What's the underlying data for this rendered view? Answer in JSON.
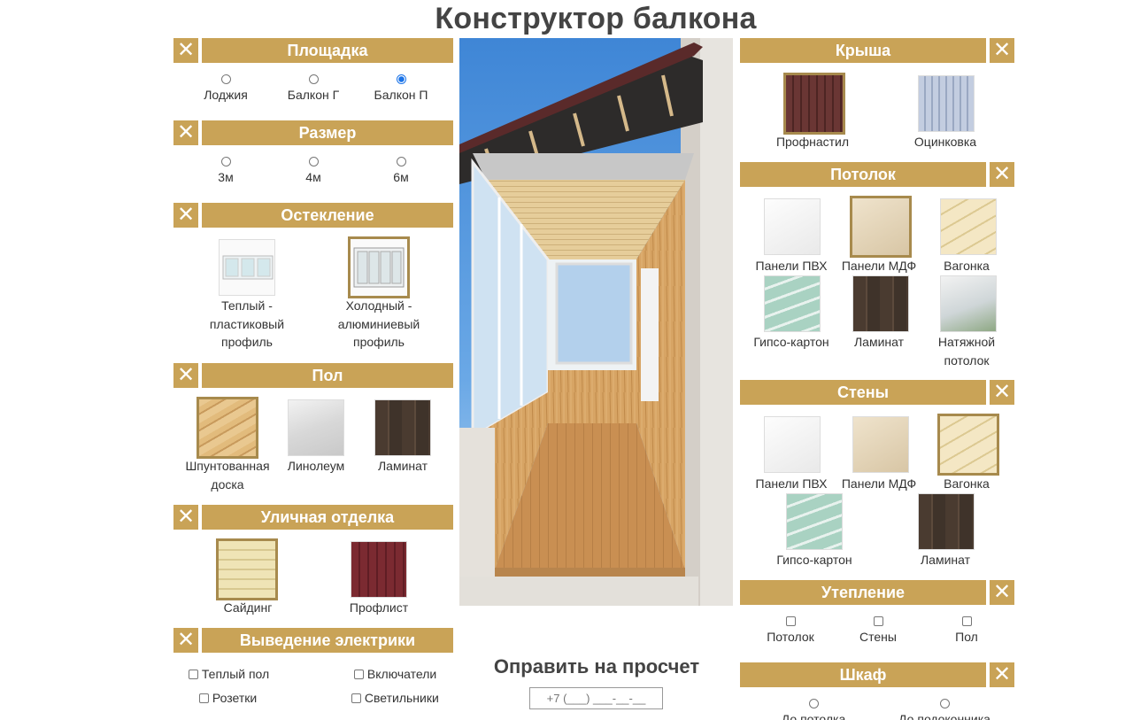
{
  "page_title": "Конструктор балкона",
  "colors": {
    "accent": "#c9a357",
    "selected_border": "#a78a4d",
    "radio_checked": "#1a73e8"
  },
  "close_glyph": "✕",
  "left": {
    "platform": {
      "title": "Площадка",
      "options": [
        "Лоджия",
        "Балкон Г",
        "Балкон П"
      ],
      "selected": "Балкон П"
    },
    "size": {
      "title": "Размер",
      "options": [
        "3м",
        "4м",
        "6м"
      ]
    },
    "glazing": {
      "title": "Остекление",
      "items": [
        {
          "label": "Теплый - пластиковый профиль",
          "line1": "Теплый -",
          "line2": "пластиковый",
          "line3": "профиль",
          "icon": "plastic-window-icon"
        },
        {
          "label": "Холодный - алюминиевый профиль",
          "line1": "Холодный -",
          "line2": "алюминиевый",
          "line3": "профиль",
          "icon": "aluminium-window-icon",
          "selected": true
        }
      ]
    },
    "floor": {
      "title": "Пол",
      "items": [
        {
          "label": "Шпунтованная доска",
          "line1": "Шпунтованная",
          "line2": "доска",
          "selected": true
        },
        {
          "label": "Линолеум"
        },
        {
          "label": "Ламинат"
        }
      ]
    },
    "exterior": {
      "title": "Уличная отделка",
      "items": [
        {
          "label": "Сайдинг",
          "selected": true
        },
        {
          "label": "Профлист"
        }
      ]
    },
    "electrics": {
      "title": "Выведение электрики",
      "items": [
        "Теплый пол",
        "Включатели",
        "Розетки",
        "Светильники"
      ]
    }
  },
  "right": {
    "roof": {
      "title": "Крыша",
      "items": [
        {
          "label": "Профнастил",
          "selected": true
        },
        {
          "label": "Оцинковка"
        }
      ]
    },
    "ceiling": {
      "title": "Потолок",
      "items": [
        {
          "label": "Панели ПВХ"
        },
        {
          "label": "Панели МДФ",
          "selected": true
        },
        {
          "label": "Вагонка"
        },
        {
          "label": "Гипсо-картон"
        },
        {
          "label": "Ламинат"
        },
        {
          "label": "Натяжной потолок",
          "line1": "Натяжной",
          "line2": "потолок"
        }
      ]
    },
    "walls": {
      "title": "Стены",
      "items": [
        {
          "label": "Панели ПВХ"
        },
        {
          "label": "Панели МДФ"
        },
        {
          "label": "Вагонка",
          "selected": true
        },
        {
          "label": "Гипсо-картон"
        },
        {
          "label": "Ламинат"
        }
      ]
    },
    "insulation": {
      "title": "Утепление",
      "items": [
        "Потолок",
        "Стены",
        "Пол"
      ]
    },
    "closet": {
      "title": "Шкаф",
      "items": [
        "До потолка",
        "До подоконника"
      ]
    }
  },
  "order": {
    "title": "Оправить на просчет",
    "phone_placeholder": "+7 (___) ___-__-__"
  }
}
